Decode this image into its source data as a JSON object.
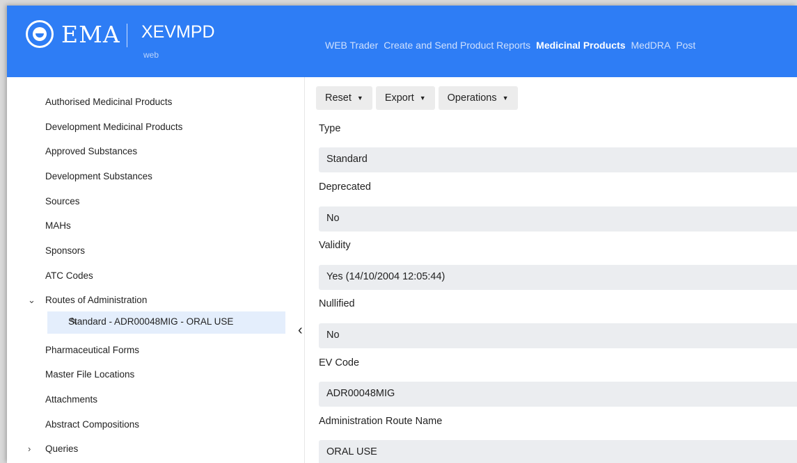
{
  "header": {
    "brand": "EMA",
    "product": "XEVMPD",
    "product_sub": "web",
    "nav": [
      "WEB Trader",
      "Create and Send Product Reports",
      "Medicinal Products",
      "MedDRA",
      "Post"
    ],
    "active_nav": "Medicinal Products",
    "color": "#2e7df5"
  },
  "sidebar": {
    "items": [
      "Authorised Medicinal Products",
      "Development Medicinal Products",
      "Approved Substances",
      "Development Substances",
      "Sources",
      "MAHs",
      "Sponsors",
      "ATC Codes",
      "Routes of Administration",
      "Pharmaceutical Forms",
      "Master File Locations",
      "Attachments",
      "Abstract Compositions",
      "Queries"
    ],
    "selected": "Standard - ADR00048MIG - ORAL USE"
  },
  "toolbar": {
    "reset": "Reset",
    "export": "Export",
    "operations": "Operations"
  },
  "fields": {
    "type": {
      "label": "Type",
      "value": "Standard"
    },
    "deprecated": {
      "label": "Deprecated",
      "value": "No"
    },
    "validity": {
      "label": "Validity",
      "value": "Yes (14/10/2004 12:05:44)"
    },
    "nullified": {
      "label": "Nullified",
      "value": "No"
    },
    "ev_code": {
      "label": "EV Code",
      "value": "ADR00048MIG"
    },
    "route_name": {
      "label": "Administration Route Name",
      "value": "ORAL USE"
    }
  }
}
